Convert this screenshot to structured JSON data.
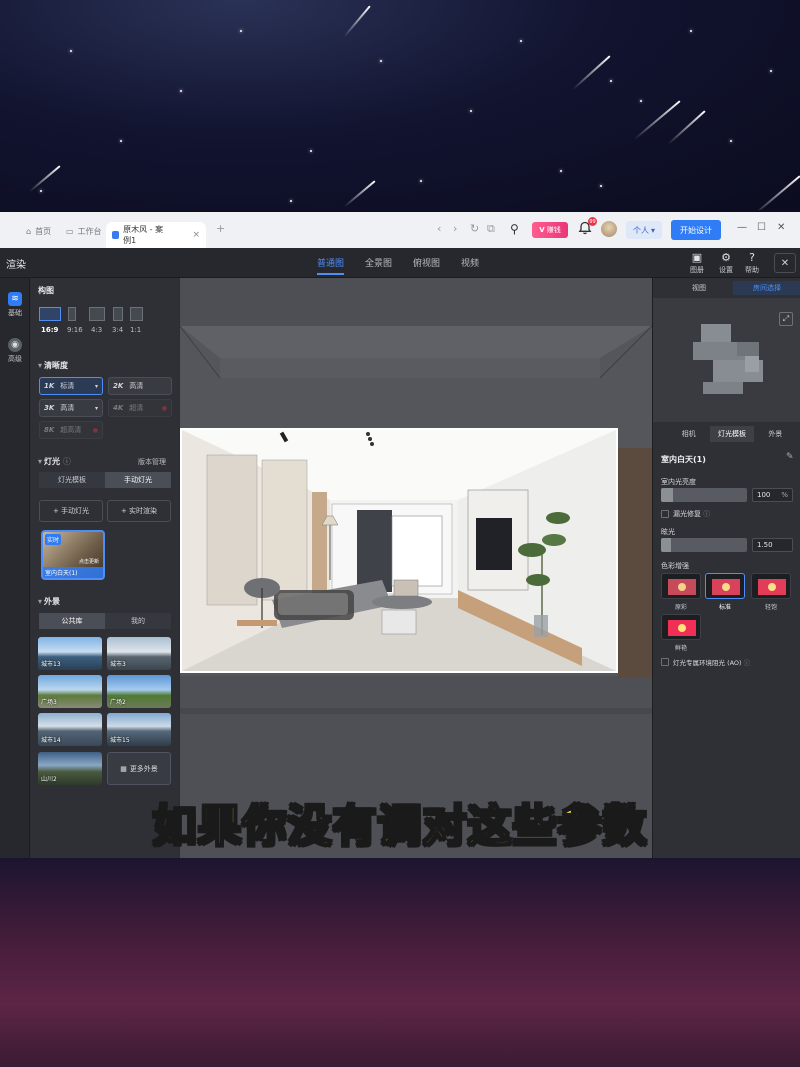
{
  "browser": {
    "tabs": [
      {
        "label": "首页"
      },
      {
        "label": "工作台"
      },
      {
        "label": "原木风 - 案例1"
      }
    ],
    "vip_label": "赚钱",
    "notification_count": "99",
    "personal_label": "个人",
    "start_design_label": "开始设计"
  },
  "app": {
    "title": "渲染",
    "view_tabs": [
      "普通图",
      "全景图",
      "俯视图",
      "视频"
    ],
    "tools": [
      {
        "label": "图册",
        "icon": "album-icon"
      },
      {
        "label": "设置",
        "icon": "gear-icon"
      },
      {
        "label": "帮助",
        "icon": "help-icon"
      }
    ]
  },
  "rail": [
    {
      "label": "基础",
      "icon": "sliders-icon"
    },
    {
      "label": "高级",
      "icon": "camera-icon"
    }
  ],
  "left": {
    "composition_title": "构图",
    "ratios": [
      "16:9",
      "9:16",
      "4:3",
      "3:4",
      "1:1"
    ],
    "clarity_title": "清晰度",
    "resolutions": [
      {
        "tier": "1K",
        "label": "标清"
      },
      {
        "tier": "2K",
        "label": "高清"
      },
      {
        "tier": "3K",
        "label": "高清"
      },
      {
        "tier": "4K",
        "label": "超清"
      },
      {
        "tier": "8K",
        "label": "超高清"
      }
    ],
    "lighting_title": "灯光",
    "version_manage": "版本管理",
    "lighting_modes": [
      "灯光模板",
      "手动灯光"
    ],
    "manual_light_btn": "+ 手动灯光",
    "realtime_render_btn": "+ 实时渲染",
    "preset": {
      "tag": "实时",
      "name": "室内白天(1)",
      "sub": "点击更新"
    },
    "exterior_title": "外景",
    "exterior_tabs": [
      "公共库",
      "我的"
    ],
    "environments": [
      "城市13",
      "城市3",
      "广场3",
      "广场2",
      "城市14",
      "城市15",
      "山川2"
    ],
    "more_env": "更多外景"
  },
  "right": {
    "top_tabs": [
      "视图",
      "房间选择"
    ],
    "sub_tabs": [
      "相机",
      "灯光模板",
      "外景"
    ],
    "template_name": "室内白天(1)",
    "indoor_brightness_label": "室内光亮度",
    "indoor_brightness_value": "100",
    "indoor_brightness_unit": "%",
    "brightness_level": 0.14,
    "overexposure_label": "漏光修复",
    "glare_label": "眩光",
    "glare_value": "1.50",
    "glare_level": 0.12,
    "color_enhance_label": "色彩增强",
    "color_options": [
      "原彩",
      "标准",
      "轻饱",
      "鲜艳"
    ],
    "ao_label": "灯光专属环境阻光 (AO)"
  },
  "subtitle": "如果你没有调对这些参数"
}
